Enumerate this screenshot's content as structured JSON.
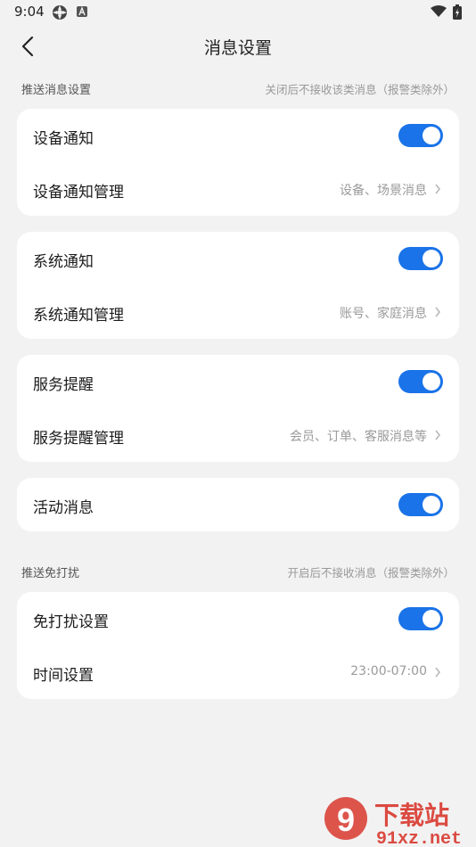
{
  "status": {
    "time": "9:04"
  },
  "nav": {
    "title": "消息设置"
  },
  "push_section": {
    "title": "推送消息设置",
    "note": "关闭后不接收该类消息（报警类除外）"
  },
  "cards": {
    "device": {
      "toggle_label": "设备通知",
      "toggle_on": true,
      "manage_label": "设备通知管理",
      "manage_value": "设备、场景消息"
    },
    "system": {
      "toggle_label": "系统通知",
      "toggle_on": true,
      "manage_label": "系统通知管理",
      "manage_value": "账号、家庭消息"
    },
    "service": {
      "toggle_label": "服务提醒",
      "toggle_on": true,
      "manage_label": "服务提醒管理",
      "manage_value": "会员、订单、客服消息等"
    },
    "activity": {
      "toggle_label": "活动消息",
      "toggle_on": true
    }
  },
  "dnd_section": {
    "title": "推送免打扰",
    "note": "开启后不接收消息（报警类除外）"
  },
  "dnd": {
    "toggle_label": "免打扰设置",
    "toggle_on": true,
    "time_label": "时间设置",
    "time_value": "23:00-07:00"
  },
  "watermark": {
    "text": "下载站",
    "url": "91xz.net"
  },
  "colors": {
    "accent": "#1a73e8",
    "background": "#f2f2f2",
    "card": "#ffffff",
    "watermark": "#d9382e"
  }
}
